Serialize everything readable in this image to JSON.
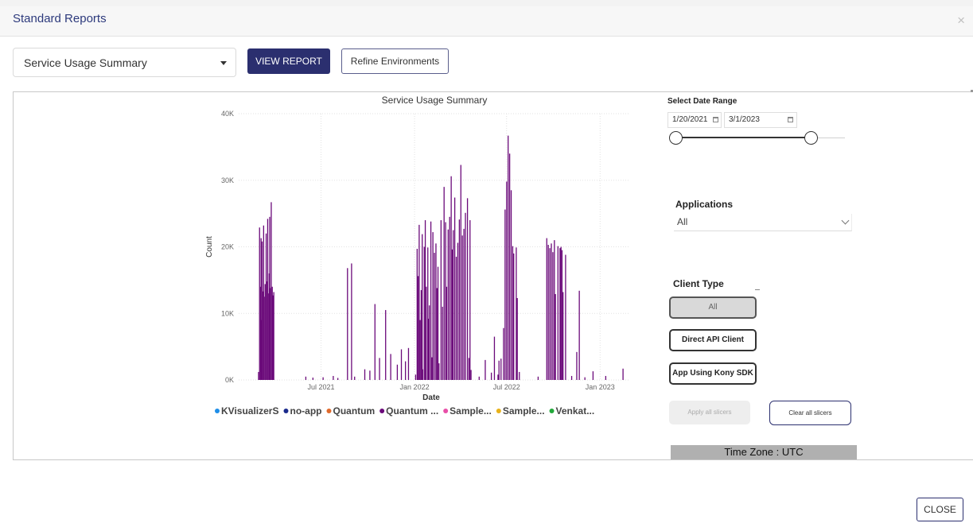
{
  "header": {
    "title": "Standard Reports",
    "close_glyph": "×"
  },
  "toolbar": {
    "report_select": "Service Usage Summary",
    "view_report_label": "VIEW REPORT",
    "refine_label": "Refine Environments"
  },
  "chart_data": {
    "type": "bar",
    "title": "Service Usage Summary",
    "xlabel": "Date",
    "ylabel": "Count",
    "ylim": [
      0,
      40000
    ],
    "yticks": [
      0,
      10000,
      20000,
      30000,
      40000
    ],
    "ytick_labels": [
      "0K",
      "10K",
      "20K",
      "30K",
      "40K"
    ],
    "xrange": [
      "2021-01-20",
      "2023-03-01"
    ],
    "xticks": [
      "2021-07-01",
      "2022-01-01",
      "2022-07-01",
      "2023-01-01"
    ],
    "xtick_labels": [
      "Jul 2021",
      "Jan 2022",
      "Jul 2022",
      "Jan 2023"
    ],
    "grid": true,
    "legend_position": "bottom",
    "legend": [
      {
        "name": "KVisualizerS",
        "color": "#1f8ee8"
      },
      {
        "name": "no-app",
        "color": "#1a2a8c"
      },
      {
        "name": "Quantum",
        "color": "#e06a2c"
      },
      {
        "name": "Quantum ...",
        "color": "#6b0a7a"
      },
      {
        "name": "Sample...",
        "color": "#e84fa8"
      },
      {
        "name": "Sample...",
        "color": "#e8b21a"
      },
      {
        "name": "Venkat...",
        "color": "#22a83a"
      }
    ],
    "bars_color": "#6b0a7a",
    "series": [
      {
        "name": "Quantum ...",
        "points": [
          [
            "2021-02-28",
            1200
          ],
          [
            "2021-03-02",
            22900
          ],
          [
            "2021-03-04",
            14000
          ],
          [
            "2021-03-05",
            21300
          ],
          [
            "2021-03-06",
            9000
          ],
          [
            "2021-03-07",
            20800
          ],
          [
            "2021-03-09",
            13300
          ],
          [
            "2021-03-10",
            23200
          ],
          [
            "2021-03-11",
            12500
          ],
          [
            "2021-03-13",
            14400
          ],
          [
            "2021-03-15",
            22000
          ],
          [
            "2021-03-16",
            14800
          ],
          [
            "2021-03-18",
            24200
          ],
          [
            "2021-03-20",
            13000
          ],
          [
            "2021-03-21",
            16000
          ],
          [
            "2021-03-22",
            24500
          ],
          [
            "2021-03-23",
            13800
          ],
          [
            "2021-03-25",
            26700
          ],
          [
            "2021-03-27",
            14000
          ],
          [
            "2021-03-28",
            12700
          ],
          [
            "2021-03-30",
            13200
          ],
          [
            "2021-06-01",
            500
          ],
          [
            "2021-06-15",
            350
          ],
          [
            "2021-07-05",
            400
          ],
          [
            "2021-07-25",
            600
          ],
          [
            "2021-08-03",
            300
          ],
          [
            "2021-08-22",
            16800
          ],
          [
            "2021-08-30",
            17500
          ],
          [
            "2021-09-05",
            500
          ],
          [
            "2021-09-25",
            1600
          ],
          [
            "2021-10-05",
            1400
          ],
          [
            "2021-10-15",
            11400
          ],
          [
            "2021-10-24",
            3300
          ],
          [
            "2021-11-05",
            10500
          ],
          [
            "2021-11-15",
            3900
          ],
          [
            "2021-11-28",
            2300
          ],
          [
            "2021-12-06",
            4600
          ],
          [
            "2021-12-14",
            2800
          ],
          [
            "2021-12-20",
            4800
          ],
          [
            "2022-01-03",
            800
          ],
          [
            "2022-01-06",
            19700
          ],
          [
            "2022-01-08",
            15600
          ],
          [
            "2022-01-10",
            23300
          ],
          [
            "2022-01-12",
            9000
          ],
          [
            "2022-01-14",
            13500
          ],
          [
            "2022-01-16",
            21900
          ],
          [
            "2022-01-17",
            1600
          ],
          [
            "2022-01-20",
            20000
          ],
          [
            "2022-01-22",
            24000
          ],
          [
            "2022-01-24",
            14000
          ],
          [
            "2022-01-27",
            19900
          ],
          [
            "2022-01-28",
            9200
          ],
          [
            "2022-01-30",
            11200
          ],
          [
            "2022-02-02",
            23800
          ],
          [
            "2022-02-04",
            3400
          ],
          [
            "2022-02-06",
            22200
          ],
          [
            "2022-02-09",
            19100
          ],
          [
            "2022-02-12",
            20500
          ],
          [
            "2022-02-14",
            13800
          ],
          [
            "2022-02-16",
            17000
          ],
          [
            "2022-02-18",
            2500
          ],
          [
            "2022-02-22",
            24000
          ],
          [
            "2022-02-25",
            11000
          ],
          [
            "2022-02-28",
            29000
          ],
          [
            "2022-03-03",
            23700
          ],
          [
            "2022-03-05",
            14000
          ],
          [
            "2022-03-08",
            22600
          ],
          [
            "2022-03-11",
            24500
          ],
          [
            "2022-03-14",
            30600
          ],
          [
            "2022-03-16",
            19600
          ],
          [
            "2022-03-18",
            22500
          ],
          [
            "2022-03-21",
            27400
          ],
          [
            "2022-03-24",
            18500
          ],
          [
            "2022-03-27",
            20600
          ],
          [
            "2022-03-30",
            24100
          ],
          [
            "2022-04-02",
            32300
          ],
          [
            "2022-04-05",
            21700
          ],
          [
            "2022-04-08",
            22700
          ],
          [
            "2022-04-11",
            25100
          ],
          [
            "2022-04-15",
            27300
          ],
          [
            "2022-04-18",
            3300
          ],
          [
            "2022-04-20",
            24000
          ],
          [
            "2022-04-22",
            1500
          ],
          [
            "2022-05-08",
            500
          ],
          [
            "2022-05-20",
            3000
          ],
          [
            "2022-06-01",
            1100
          ],
          [
            "2022-06-07",
            6500
          ],
          [
            "2022-06-14",
            800
          ],
          [
            "2022-06-16",
            2900
          ],
          [
            "2022-06-20",
            3200
          ],
          [
            "2022-06-25",
            7800
          ],
          [
            "2022-06-28",
            25600
          ],
          [
            "2022-07-01",
            29800
          ],
          [
            "2022-07-04",
            36700
          ],
          [
            "2022-07-07",
            34000
          ],
          [
            "2022-07-10",
            28500
          ],
          [
            "2022-07-13",
            20100
          ],
          [
            "2022-07-15",
            19000
          ],
          [
            "2022-07-20",
            19900
          ],
          [
            "2022-07-22",
            12300
          ],
          [
            "2022-07-26",
            1200
          ],
          [
            "2022-09-01",
            500
          ],
          [
            "2022-09-18",
            21300
          ],
          [
            "2022-09-21",
            20300
          ],
          [
            "2022-09-24",
            19800
          ],
          [
            "2022-09-27",
            20500
          ],
          [
            "2022-09-30",
            19200
          ],
          [
            "2022-10-03",
            21000
          ],
          [
            "2022-10-05",
            12900
          ],
          [
            "2022-10-10",
            20100
          ],
          [
            "2022-10-14",
            19800
          ],
          [
            "2022-10-16",
            20000
          ],
          [
            "2022-10-18",
            19500
          ],
          [
            "2022-10-20",
            13200
          ],
          [
            "2022-10-25",
            18800
          ],
          [
            "2022-11-06",
            600
          ],
          [
            "2022-11-16",
            4200
          ],
          [
            "2022-11-21",
            13400
          ],
          [
            "2022-12-02",
            400
          ],
          [
            "2022-12-18",
            1300
          ],
          [
            "2023-01-12",
            600
          ],
          [
            "2023-02-15",
            1700
          ]
        ]
      }
    ]
  },
  "filters": {
    "date_range_label": "Select Date Range",
    "start_date": "1/20/2021",
    "end_date": "3/1/2023",
    "applications_label": "Applications",
    "applications_value": "All",
    "client_type_label": "Client Type",
    "client_all": "All",
    "client_direct": "Direct API Client",
    "client_app": "App Using Kony SDK",
    "apply_label": "Apply all slicers",
    "clear_label": "Clear all slicers",
    "timezone": "Time Zone : UTC"
  },
  "footer": {
    "close_label": "CLOSE"
  }
}
